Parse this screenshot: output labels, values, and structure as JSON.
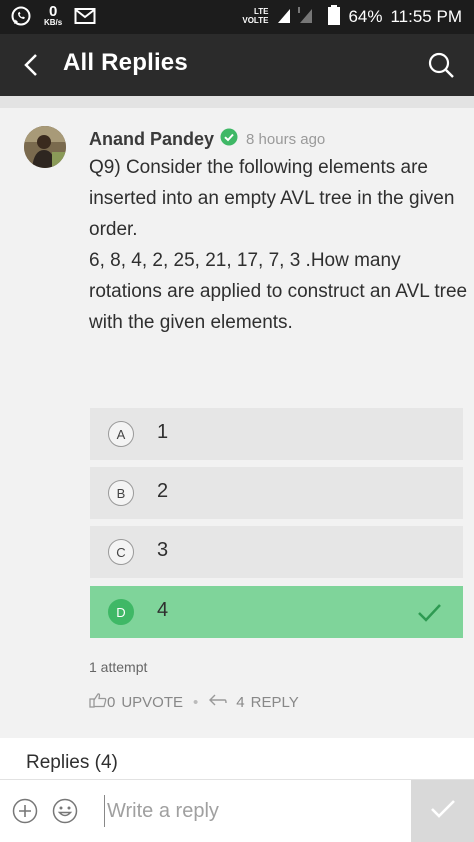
{
  "status_bar": {
    "net_speed": "0",
    "net_unit": "KB/s",
    "lte": "LTE",
    "volte": "VOLTE",
    "battery": "64%",
    "time": "11:55 PM"
  },
  "app_bar": {
    "title": "All Replies",
    "back_icon": "chevron-left-icon",
    "search_icon": "search-icon"
  },
  "post": {
    "author": "Anand Pandey",
    "verified_icon": "verified-check-icon",
    "time_ago": "8 hours ago",
    "question_lines": [
      "Q9) Consider the following elements are inserted into an empty AVL tree in the given order.",
      "6, 8, 4, 2, 25, 21, 17, 7, 3 .How many rotations are applied to construct an AVL tree with the given elements."
    ],
    "options": [
      {
        "letter": "A",
        "value": "1",
        "correct": false
      },
      {
        "letter": "B",
        "value": "2",
        "correct": false
      },
      {
        "letter": "C",
        "value": "3",
        "correct": false
      },
      {
        "letter": "D",
        "value": "4",
        "correct": true
      }
    ],
    "attempts": "1 attempt",
    "upvote_count": "0",
    "upvote_label": "UPVOTE",
    "reply_count": "4",
    "reply_label": "REPLY"
  },
  "replies_header": "Replies (4)",
  "composer": {
    "placeholder": "Write a reply"
  },
  "colors": {
    "app_bar": "#2b2b2b",
    "status_bar": "#1c1c1c",
    "card": "#f2f2f2",
    "option": "#e6e6e6",
    "correct_option": "#7fd49a",
    "correct_badge": "#3fb866",
    "verified": "#3fb866"
  }
}
